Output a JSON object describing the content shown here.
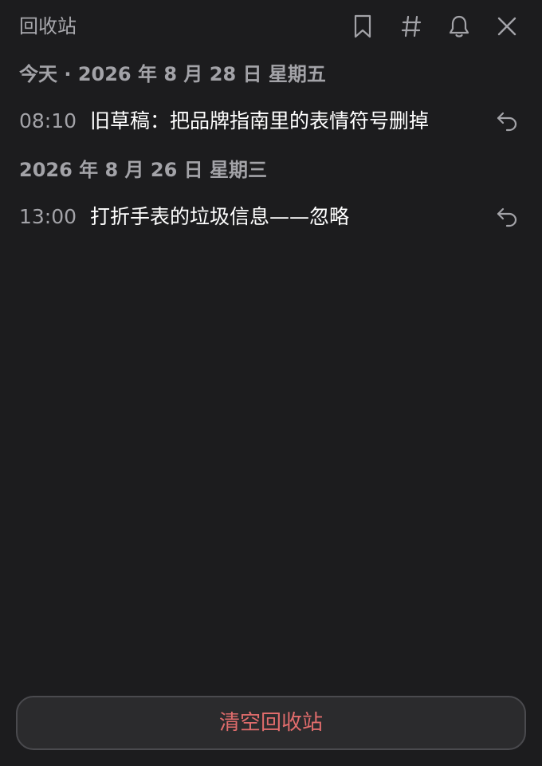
{
  "header": {
    "title": "回收站",
    "icons": [
      "bookmark-icon",
      "hashtag-icon",
      "bell-icon",
      "close-icon"
    ]
  },
  "sections": [
    {
      "date_label": "今天 · 2026 年 8 月 28 日 星期五",
      "items": [
        {
          "time": "08:10",
          "text": "旧草稿：把品牌指南里的表情符号删掉"
        }
      ]
    },
    {
      "date_label": "2026 年 8 月 26 日 星期三",
      "items": [
        {
          "time": "13:00",
          "text": "打折手表的垃圾信息——忽略"
        }
      ]
    }
  ],
  "footer": {
    "empty_label": "清空回收站"
  },
  "colors": {
    "background": "#1c1c1e",
    "muted_text": "#a3a3a8",
    "danger": "#e06c6c",
    "button_bg": "#2b2b2d",
    "button_border": "#4a4a4e"
  }
}
